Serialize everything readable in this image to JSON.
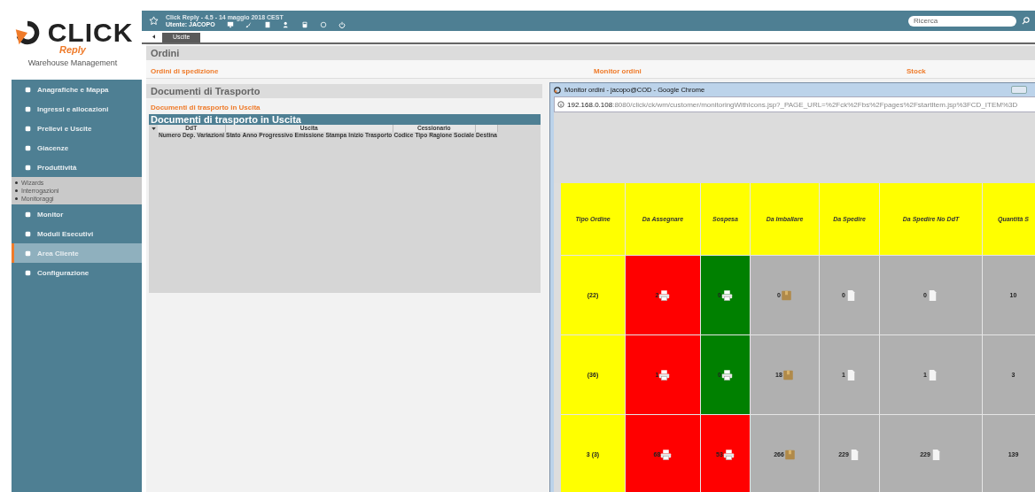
{
  "header": {
    "title": "Click Reply - 4.5 - 14 maggio 2018 CEST",
    "user": "Utente: JACOPO",
    "search": {
      "placeholder": "Ricerca"
    }
  },
  "sidebar": {
    "brand": "CLICK",
    "brand_sub": "Reply",
    "product": "Warehouse Management",
    "items": [
      {
        "label": "Anagrafiche e Mappa",
        "selected": false
      },
      {
        "label": "Ingressi e allocazioni",
        "selected": false
      },
      {
        "label": "Prelievi e Uscite",
        "selected": false
      },
      {
        "label": "Giacenze",
        "selected": false
      },
      {
        "label": "Produttività",
        "selected": false,
        "children": [
          {
            "label": "Wizards"
          },
          {
            "label": "Interrogazioni"
          },
          {
            "label": "Monitoraggi"
          }
        ]
      },
      {
        "label": "Monitor",
        "selected": false
      },
      {
        "label": "Moduli Esecutivi",
        "selected": false
      },
      {
        "label": "Area Cliente",
        "selected": true
      },
      {
        "label": "Configurazione",
        "selected": false
      }
    ]
  },
  "tabs": [
    {
      "label": "Uscite",
      "selected": true
    }
  ],
  "ordini": {
    "title": "Ordini",
    "links": [
      "Ordini di spedizione",
      "Monitor ordini",
      "Stock"
    ]
  },
  "documenti": {
    "title": "Documenti di Trasporto",
    "link": "Documenti di trasporto in Uscita",
    "table": {
      "title": "Documenti di trasporto in Uscita",
      "groups": [
        {
          "label": "DdT",
          "columns": [
            "Numero",
            "Dep.",
            "Variazioni"
          ]
        },
        {
          "label": "Uscita",
          "columns": [
            "Stato",
            "Anno",
            "Progressivo",
            "Emissione",
            "Stampa",
            "Inizio Trasporto"
          ]
        },
        {
          "label": "Cessionario",
          "columns": [
            "Codice",
            "Tipo",
            "Ragione Sociale"
          ]
        },
        {
          "columns": [
            "Destina"
          ]
        }
      ]
    }
  },
  "popup": {
    "title": "Monitor ordini - jacopo@COD - Google Chrome",
    "url_host": "192.168.0.108",
    "url_rest": ":8080/click/ck/wm/customer/monitoringWithIcons.jsp?_PAGE_URL=%2Fck%2Fbs%2Fpages%2FstartItem.jsp%3FCD_ITEM%3D",
    "columns": [
      "Tipo Ordine",
      "Da Assegnare",
      "Sospesa",
      "Da Imballare",
      "Da Spedire",
      "Da Spedire No DdT",
      "Quantità S"
    ],
    "rows": [
      [
        {
          "value": "(22)",
          "color": "#ffff00",
          "kind": "plain"
        },
        {
          "value": "2",
          "color": "#ff0000",
          "kind": "printer"
        },
        {
          "value": "0",
          "color": "#008000",
          "kind": "printer"
        },
        {
          "value": "0",
          "color": "#b0b0b0",
          "kind": "box"
        },
        {
          "value": "0",
          "color": "#b0b0b0",
          "kind": "page"
        },
        {
          "value": "0",
          "color": "#b0b0b0",
          "kind": "page"
        },
        {
          "value": "10",
          "color": "#b0b0b0",
          "kind": "plain"
        }
      ],
      [
        {
          "value": "(36)",
          "color": "#ffff00",
          "kind": "plain"
        },
        {
          "value": "1",
          "color": "#ff0000",
          "kind": "printer"
        },
        {
          "value": "0",
          "color": "#008000",
          "kind": "printer"
        },
        {
          "value": "18",
          "color": "#b0b0b0",
          "kind": "box"
        },
        {
          "value": "1",
          "color": "#b0b0b0",
          "kind": "page"
        },
        {
          "value": "1",
          "color": "#b0b0b0",
          "kind": "page"
        },
        {
          "value": "3",
          "color": "#b0b0b0",
          "kind": "plain"
        }
      ],
      [
        {
          "value": "3 (3)",
          "color": "#ffff00",
          "kind": "plain"
        },
        {
          "value": "68",
          "color": "#ff0000",
          "kind": "printer"
        },
        {
          "value": "53",
          "color": "#ff0000",
          "kind": "printer"
        },
        {
          "value": "266",
          "color": "#b0b0b0",
          "kind": "box"
        },
        {
          "value": "229",
          "color": "#b0b0b0",
          "kind": "page"
        },
        {
          "value": "229",
          "color": "#b0b0b0",
          "kind": "page"
        },
        {
          "value": "139",
          "color": "#b0b0b0",
          "kind": "plain"
        }
      ]
    ]
  }
}
